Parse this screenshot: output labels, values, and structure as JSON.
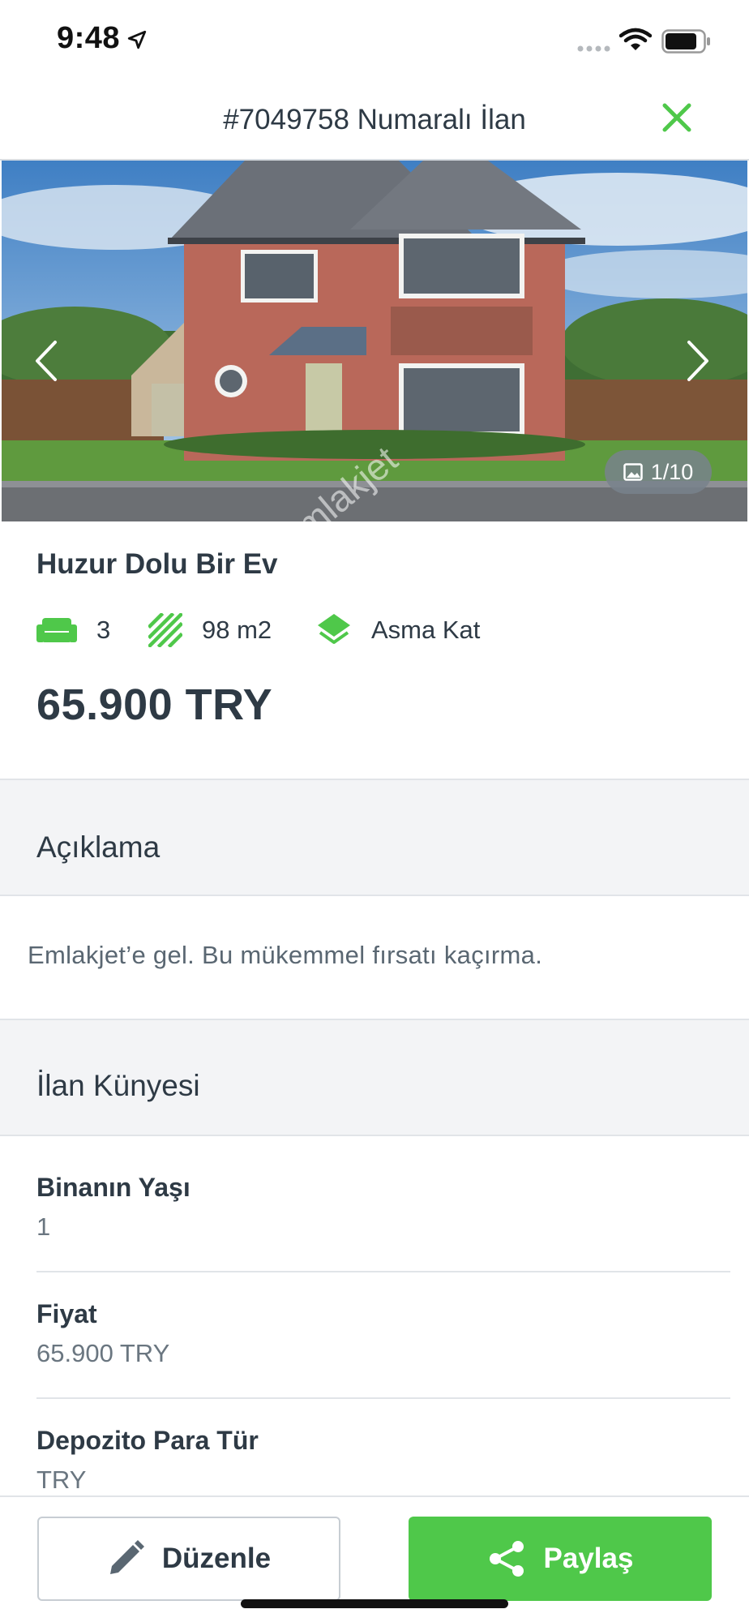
{
  "status_bar": {
    "time": "9:48"
  },
  "nav": {
    "title": "#7049758 Numaralı İlan",
    "close_icon": "close-icon",
    "accent_color": "#4fc84a"
  },
  "gallery": {
    "counter": "1/10",
    "watermark": "emlakjet"
  },
  "listing": {
    "title": "Huzur Dolu Bir Ev",
    "features": [
      {
        "icon": "sofa-icon",
        "value": "3"
      },
      {
        "icon": "area-icon",
        "value": "98 m2"
      },
      {
        "icon": "layers-icon",
        "value": "Asma Kat"
      }
    ],
    "price": "65.900 TRY"
  },
  "description_section": {
    "header": "Açıklama",
    "text": "Emlakjet’e gel. Bu mükemmel fırsatı kaçırma."
  },
  "details_section": {
    "header": "İlan Künyesi",
    "items": [
      {
        "label": "Binanın Yaşı",
        "value": "1"
      },
      {
        "label": "Fiyat",
        "value": "65.900 TRY"
      },
      {
        "label": "Depozito Para Tür",
        "value": "TRY"
      }
    ]
  },
  "actions": {
    "edit_label": "Düzenle",
    "share_label": "Paylaş",
    "share_color": "#4fc84a"
  }
}
